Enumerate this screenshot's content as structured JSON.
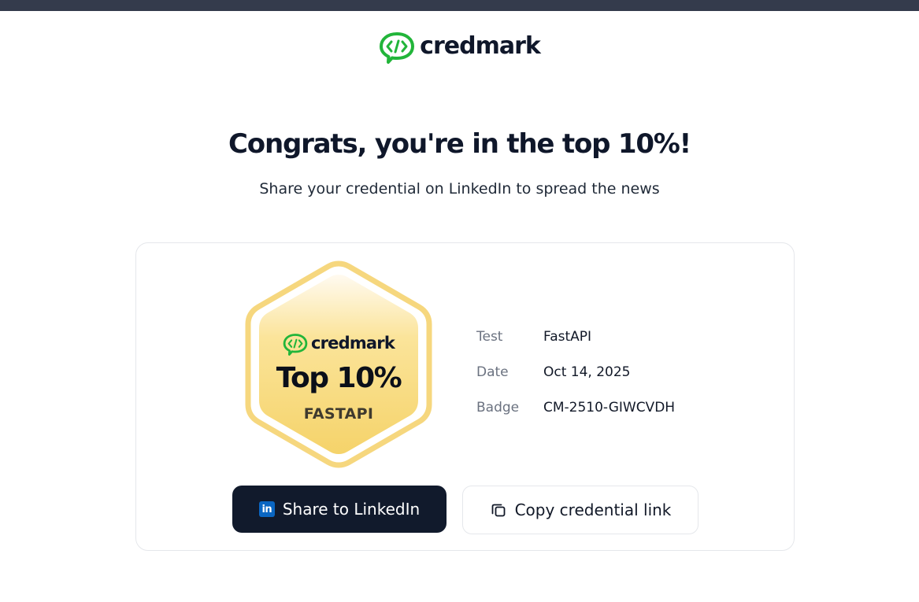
{
  "brand": {
    "name": "credmark",
    "accent": "#22b53a"
  },
  "hero": {
    "title": "Congrats, you're in the top 10%!",
    "subtitle": "Share your credential on LinkedIn to spread the news"
  },
  "badge": {
    "brand": "credmark",
    "rank": "Top 10%",
    "skill": "FASTAPI",
    "colors": {
      "outer": "#f7dc8a",
      "inner": "#f6d36b"
    }
  },
  "details": [
    {
      "label": "Test",
      "value": "FastAPI"
    },
    {
      "label": "Date",
      "value": "Oct 14, 2025"
    },
    {
      "label": "Badge",
      "value": "CM-2510-GIWCVDH"
    }
  ],
  "actions": {
    "linkedin_icon": "in",
    "linkedin_label": "Share to LinkedIn",
    "copy_label": "Copy credential link"
  }
}
